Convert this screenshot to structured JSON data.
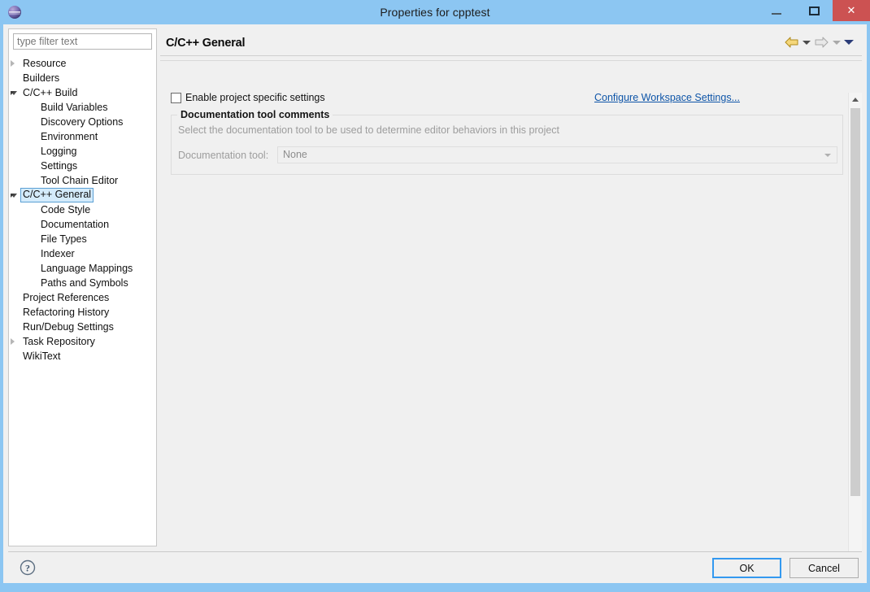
{
  "window": {
    "title": "Properties for cpptest",
    "app_icon": "eclipse-icon",
    "minimize_label": "Minimize",
    "maximize_label": "Maximize",
    "close_label": "Close",
    "accent_blue": "#8cc6f2",
    "close_red": "#cc5252"
  },
  "sidebar": {
    "filter": {
      "value": "",
      "placeholder": "type filter text"
    },
    "items": [
      {
        "label": "Resource",
        "indent": 0,
        "twisty": "collapsed",
        "selected": false
      },
      {
        "label": "Builders",
        "indent": 0,
        "twisty": "none",
        "selected": false
      },
      {
        "label": "C/C++ Build",
        "indent": 0,
        "twisty": "expanded",
        "selected": false
      },
      {
        "label": "Build Variables",
        "indent": 1,
        "twisty": "none",
        "selected": false
      },
      {
        "label": "Discovery Options",
        "indent": 1,
        "twisty": "none",
        "selected": false
      },
      {
        "label": "Environment",
        "indent": 1,
        "twisty": "none",
        "selected": false
      },
      {
        "label": "Logging",
        "indent": 1,
        "twisty": "none",
        "selected": false
      },
      {
        "label": "Settings",
        "indent": 1,
        "twisty": "none",
        "selected": false
      },
      {
        "label": "Tool Chain Editor",
        "indent": 1,
        "twisty": "none",
        "selected": false
      },
      {
        "label": "C/C++ General",
        "indent": 0,
        "twisty": "expanded",
        "selected": true
      },
      {
        "label": "Code Style",
        "indent": 1,
        "twisty": "none",
        "selected": false
      },
      {
        "label": "Documentation",
        "indent": 1,
        "twisty": "none",
        "selected": false
      },
      {
        "label": "File Types",
        "indent": 1,
        "twisty": "none",
        "selected": false
      },
      {
        "label": "Indexer",
        "indent": 1,
        "twisty": "none",
        "selected": false
      },
      {
        "label": "Language Mappings",
        "indent": 1,
        "twisty": "none",
        "selected": false
      },
      {
        "label": "Paths and Symbols",
        "indent": 1,
        "twisty": "none",
        "selected": false
      },
      {
        "label": "Project References",
        "indent": 0,
        "twisty": "none",
        "selected": false
      },
      {
        "label": "Refactoring History",
        "indent": 0,
        "twisty": "none",
        "selected": false
      },
      {
        "label": "Run/Debug Settings",
        "indent": 0,
        "twisty": "none",
        "selected": false
      },
      {
        "label": "Task Repository",
        "indent": 0,
        "twisty": "collapsed",
        "selected": false
      },
      {
        "label": "WikiText",
        "indent": 0,
        "twisty": "none",
        "selected": false
      }
    ]
  },
  "page": {
    "title": "C/C++ General",
    "nav": {
      "back_icon": "back-arrow-icon",
      "back_menu_icon": "chevron-down-icon",
      "forward_icon": "forward-arrow-icon",
      "forward_menu_icon": "chevron-down-icon",
      "history_menu_icon": "chevron-down-icon"
    },
    "enable_specific": {
      "label": "Enable project specific settings",
      "checked": false
    },
    "workspace_link": "Configure Workspace Settings...",
    "group": {
      "title": "Documentation tool comments",
      "description": "Select the documentation tool to be used to determine editor behaviors in this project",
      "combo_label": "Documentation tool:",
      "combo_value": "None",
      "combo_options": [
        "None"
      ],
      "enabled": false
    },
    "scrollbar": {
      "up_icon": "chevron-up-icon",
      "down_icon": "chevron-down-icon"
    }
  },
  "footer": {
    "help_icon": "help-question-icon",
    "ok_label": "OK",
    "cancel_label": "Cancel"
  }
}
